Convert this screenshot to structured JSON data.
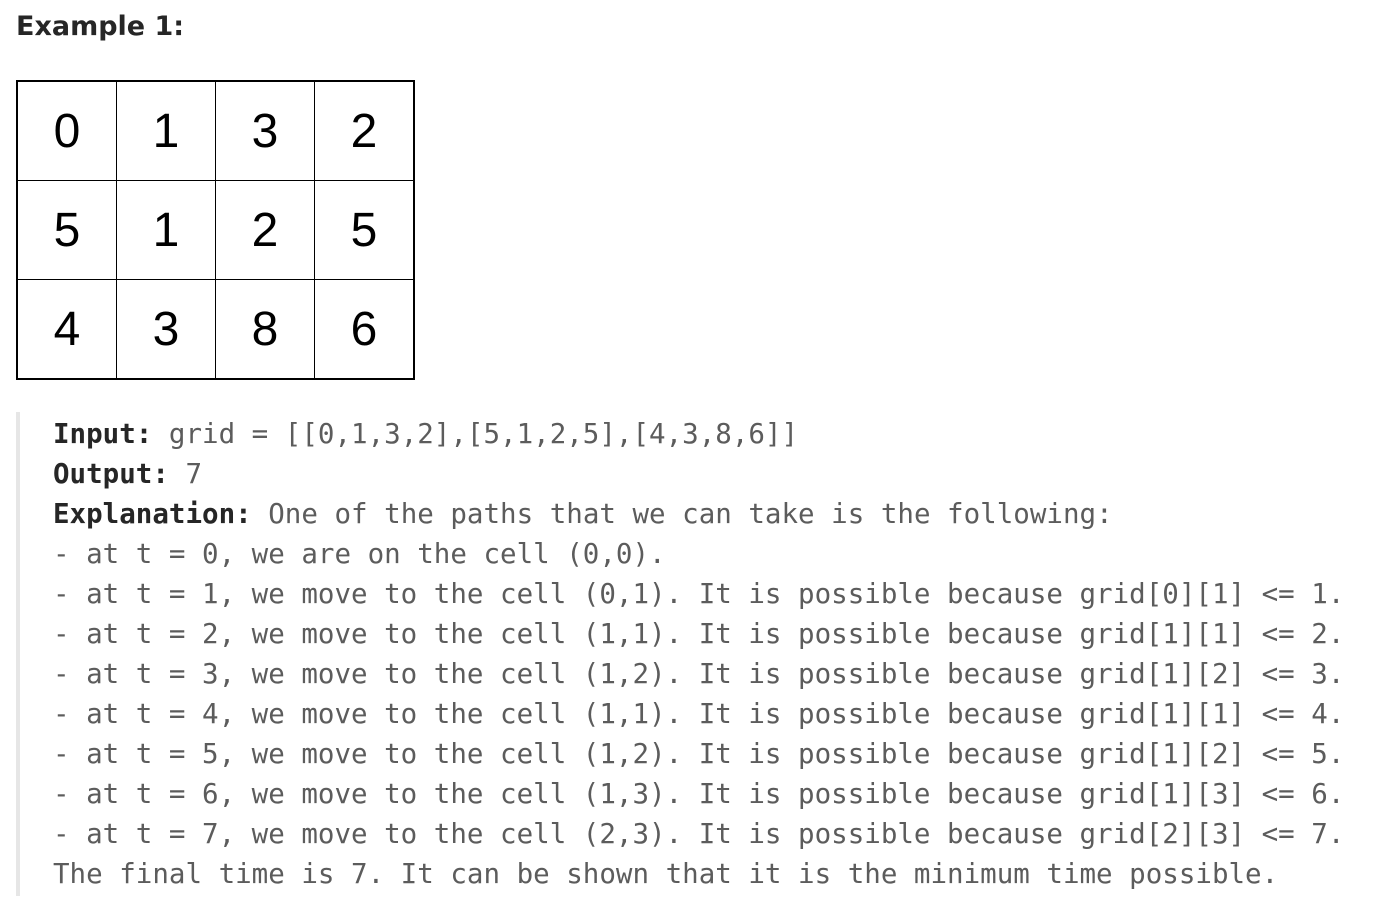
{
  "title": "Example 1:",
  "grid": [
    [
      "0",
      "1",
      "3",
      "2"
    ],
    [
      "5",
      "1",
      "2",
      "5"
    ],
    [
      "4",
      "3",
      "8",
      "6"
    ]
  ],
  "io": {
    "input_label": "Input:",
    "input_value": " grid = [[0,1,3,2],[5,1,2,5],[4,3,8,6]]",
    "output_label": "Output:",
    "output_value": " 7",
    "explanation_label": "Explanation:",
    "explanation_value": " One of the paths that we can take is the following:",
    "steps": [
      "- at t = 0, we are on the cell (0,0).",
      "- at t = 1, we move to the cell (0,1). It is possible because grid[0][1] <= 1.",
      "- at t = 2, we move to the cell (1,1). It is possible because grid[1][1] <= 2.",
      "- at t = 3, we move to the cell (1,2). It is possible because grid[1][2] <= 3.",
      "- at t = 4, we move to the cell (1,1). It is possible because grid[1][1] <= 4.",
      "- at t = 5, we move to the cell (1,2). It is possible because grid[1][2] <= 5.",
      "- at t = 6, we move to the cell (1,3). It is possible because grid[1][3] <= 6.",
      "- at t = 7, we move to the cell (2,3). It is possible because grid[2][3] <= 7."
    ],
    "conclusion": "The final time is 7. It can be shown that it is the minimum time possible."
  }
}
